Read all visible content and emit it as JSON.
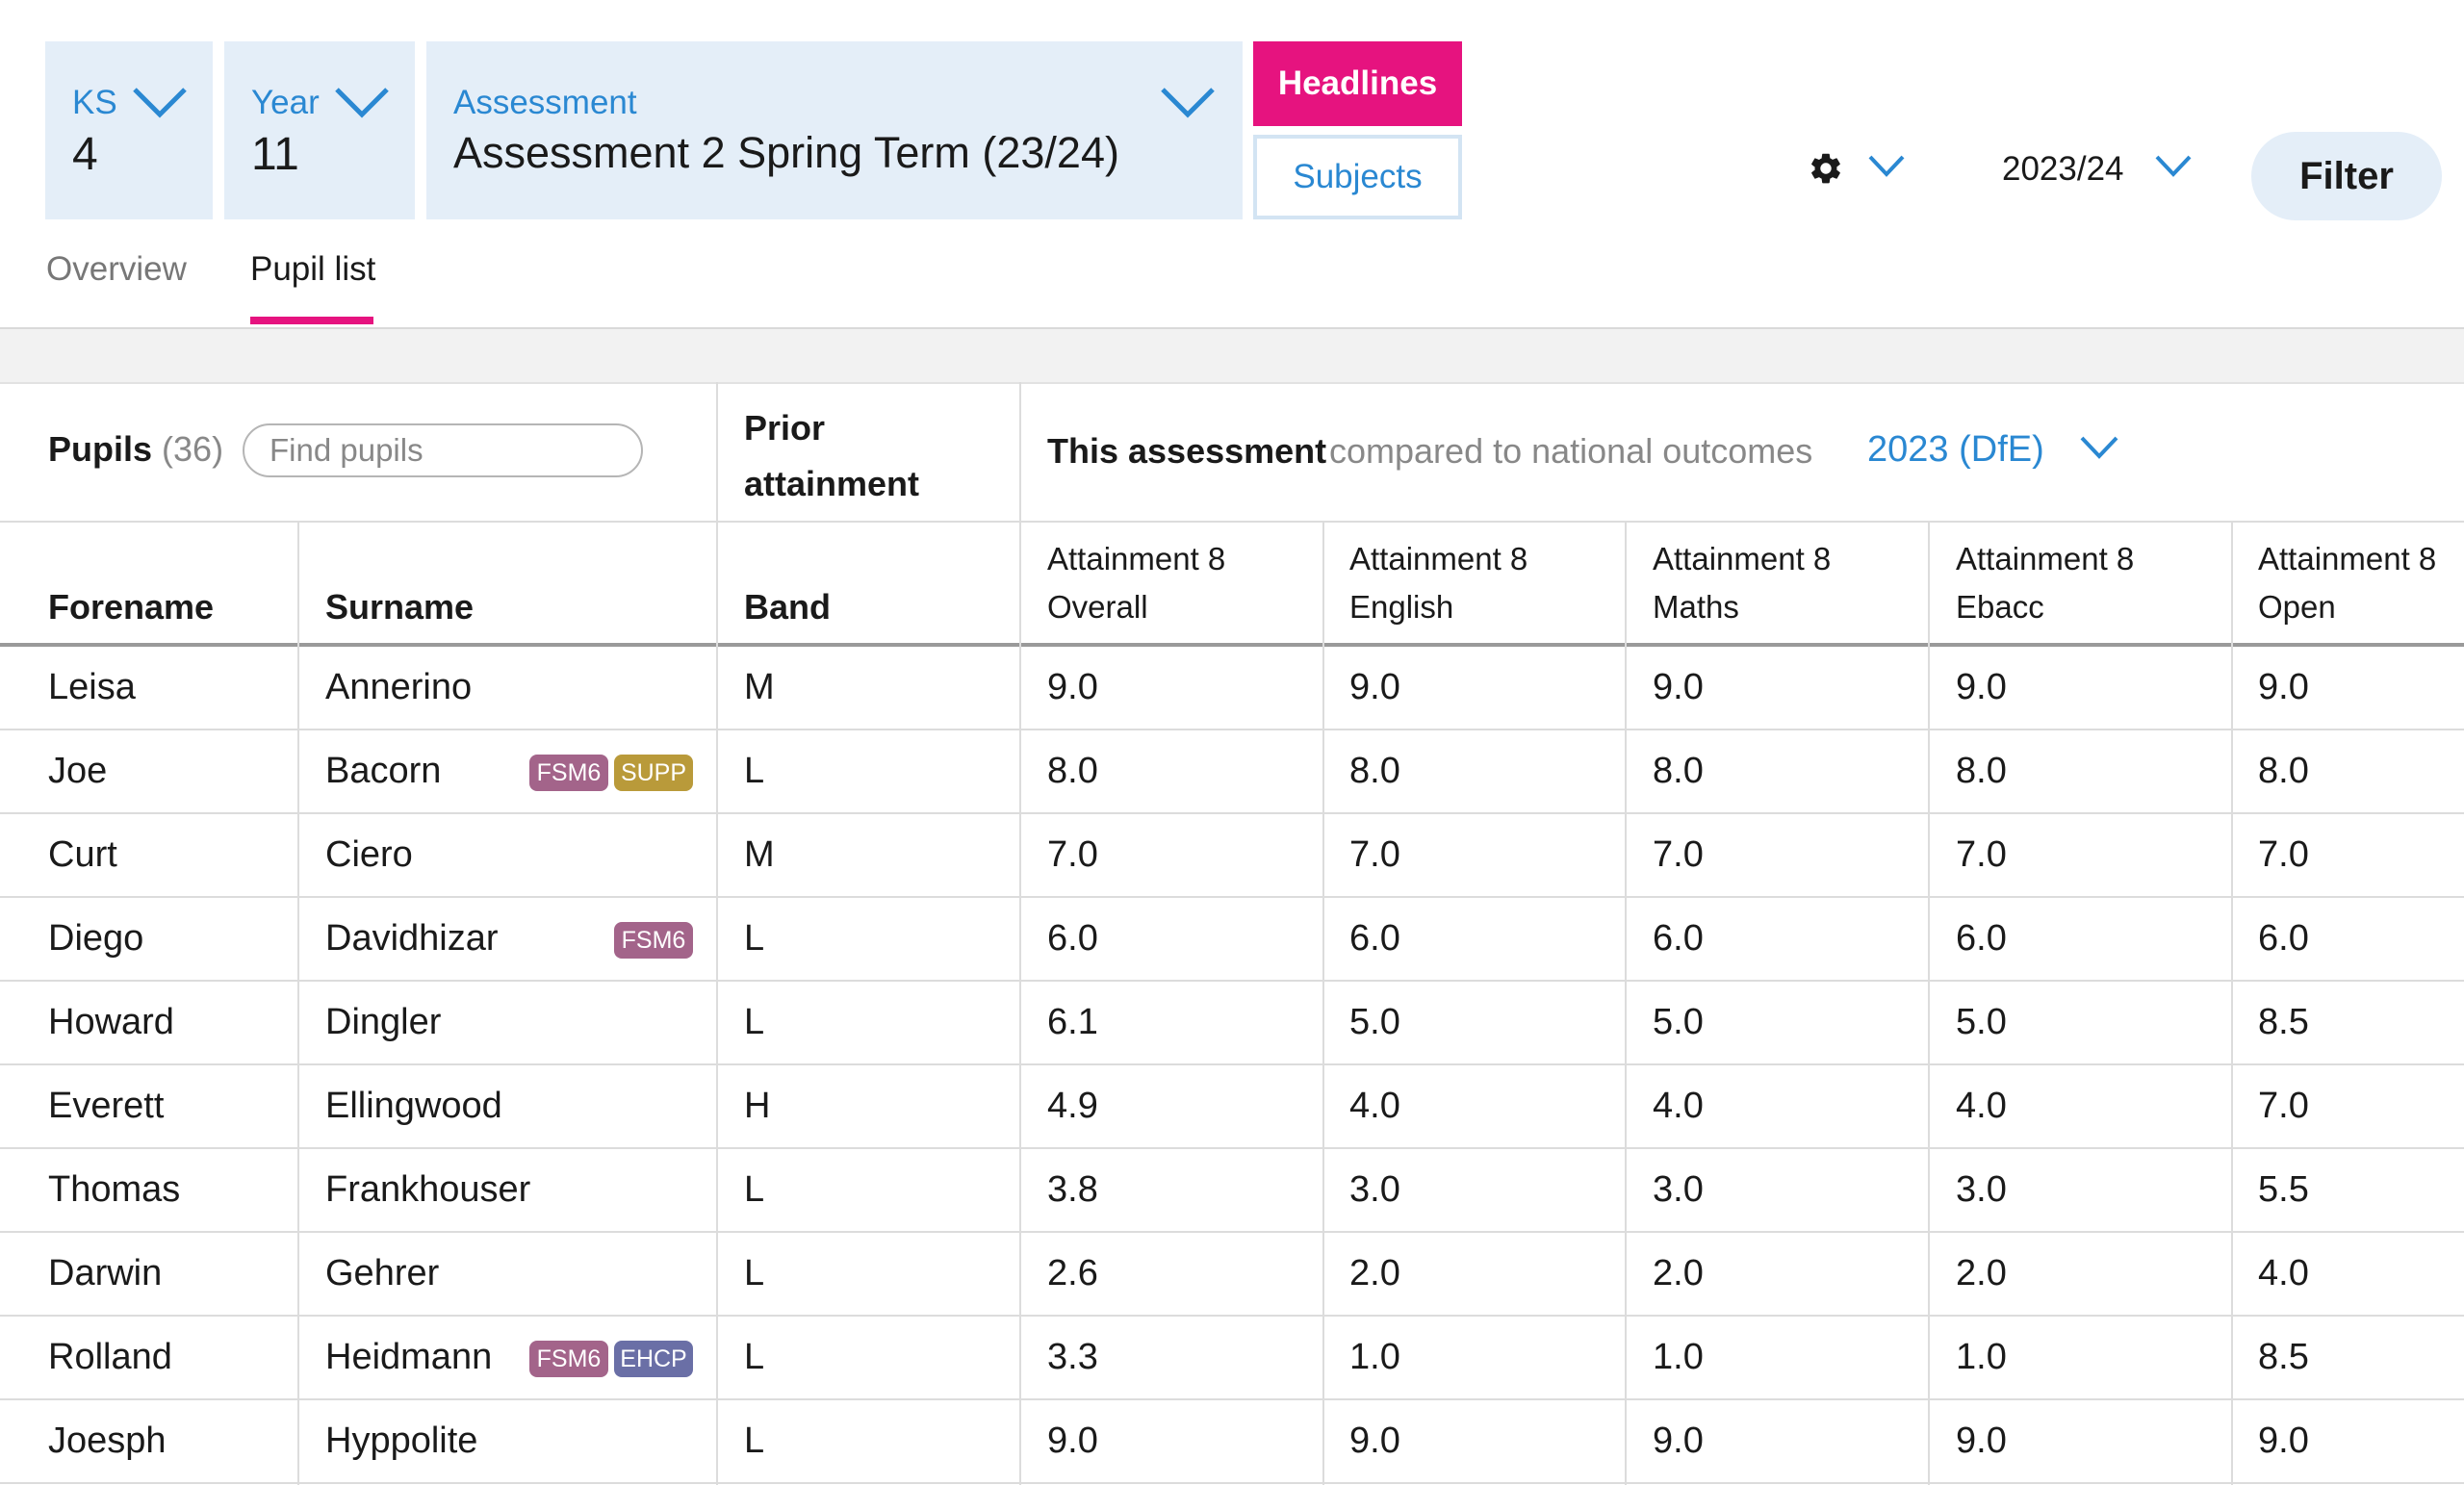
{
  "filters": {
    "ks": {
      "label": "KS",
      "value": "4"
    },
    "year": {
      "label": "Year",
      "value": "11"
    },
    "assessment": {
      "label": "Assessment",
      "value": "Assessment 2 Spring Term (23/24)"
    }
  },
  "buttons": {
    "headlines": "Headlines",
    "subjects": "Subjects",
    "filter": "Filter"
  },
  "academic_year": "2023/24",
  "tabs": [
    {
      "label": "Overview",
      "active": false
    },
    {
      "label": "Pupil list",
      "active": true
    }
  ],
  "table_header": {
    "pupils_label": "Pupils",
    "pupils_count": "(36)",
    "search_placeholder": "Find pupils",
    "prior_attainment": [
      "Prior",
      "attainment"
    ],
    "this_assessment": "This assessment",
    "compared_to": "compared to national outcomes",
    "national_dataset": "2023 (DfE)",
    "columns": {
      "forename": "Forename",
      "surname": "Surname",
      "band": "Band",
      "a8_overall": [
        "Attainment 8",
        "Overall"
      ],
      "a8_english": [
        "Attainment 8",
        "English"
      ],
      "a8_maths": [
        "Attainment 8",
        "Maths"
      ],
      "a8_ebacc": [
        "Attainment 8",
        "Ebacc"
      ],
      "a8_open": [
        "Attainment 8",
        "Open"
      ]
    }
  },
  "badge_colors": {
    "FSM6": "#a3648a",
    "SUPP": "#b99a3a",
    "EHCP": "#6a6fa6"
  },
  "pupils": [
    {
      "forename": "Leisa",
      "surname": "Annerino",
      "badges": [],
      "band": "M",
      "scores": [
        "9.0",
        "9.0",
        "9.0",
        "9.0",
        "9.0"
      ]
    },
    {
      "forename": "Joe",
      "surname": "Bacorn",
      "badges": [
        "FSM6",
        "SUPP"
      ],
      "band": "L",
      "scores": [
        "8.0",
        "8.0",
        "8.0",
        "8.0",
        "8.0"
      ]
    },
    {
      "forename": "Curt",
      "surname": "Ciero",
      "badges": [],
      "band": "M",
      "scores": [
        "7.0",
        "7.0",
        "7.0",
        "7.0",
        "7.0"
      ]
    },
    {
      "forename": "Diego",
      "surname": "Davidhizar",
      "badges": [
        "FSM6"
      ],
      "band": "L",
      "scores": [
        "6.0",
        "6.0",
        "6.0",
        "6.0",
        "6.0"
      ]
    },
    {
      "forename": "Howard",
      "surname": "Dingler",
      "badges": [],
      "band": "L",
      "scores": [
        "6.1",
        "5.0",
        "5.0",
        "5.0",
        "8.5"
      ]
    },
    {
      "forename": "Everett",
      "surname": "Ellingwood",
      "badges": [],
      "band": "H",
      "scores": [
        "4.9",
        "4.0",
        "4.0",
        "4.0",
        "7.0"
      ]
    },
    {
      "forename": "Thomas",
      "surname": "Frankhouser",
      "badges": [],
      "band": "L",
      "scores": [
        "3.8",
        "3.0",
        "3.0",
        "3.0",
        "5.5"
      ]
    },
    {
      "forename": "Darwin",
      "surname": "Gehrer",
      "badges": [],
      "band": "L",
      "scores": [
        "2.6",
        "2.0",
        "2.0",
        "2.0",
        "4.0"
      ]
    },
    {
      "forename": "Rolland",
      "surname": "Heidmann",
      "badges": [
        "FSM6",
        "EHCP"
      ],
      "band": "L",
      "scores": [
        "3.3",
        "1.0",
        "1.0",
        "1.0",
        "8.5"
      ]
    },
    {
      "forename": "Joesph",
      "surname": "Hyppolite",
      "badges": [],
      "band": "L",
      "scores": [
        "9.0",
        "9.0",
        "9.0",
        "9.0",
        "9.0"
      ]
    }
  ]
}
